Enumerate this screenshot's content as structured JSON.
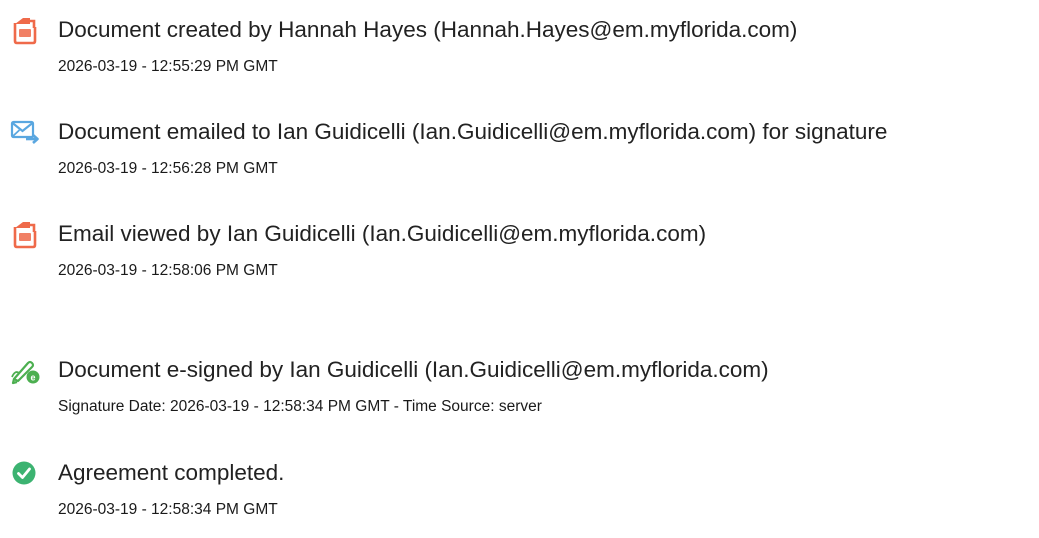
{
  "colors": {
    "doc_icon": "#ef6a4a",
    "email_icon": "#5aa7e0",
    "sign_icon": "#4caf50",
    "check_icon": "#3cb371"
  },
  "events": [
    {
      "icon": "document-icon",
      "title": "Document created by Hannah Hayes (Hannah.Hayes@em.myflorida.com)",
      "timestamp": "2026-03-19 - 12:55:29 PM GMT"
    },
    {
      "icon": "email-sent-icon",
      "title": "Document emailed to Ian Guidicelli (Ian.Guidicelli@em.myflorida.com) for signature",
      "timestamp": "2026-03-19 - 12:56:28 PM GMT"
    },
    {
      "icon": "document-icon",
      "title": "Email viewed by Ian Guidicelli (Ian.Guidicelli@em.myflorida.com)",
      "timestamp": "2026-03-19 - 12:58:06 PM GMT"
    },
    {
      "icon": "esign-pen-icon",
      "title": "Document e-signed by Ian Guidicelli (Ian.Guidicelli@em.myflorida.com)",
      "timestamp": "Signature Date: 2026-03-19 - 12:58:34 PM GMT - Time Source: server"
    },
    {
      "icon": "check-circle-icon",
      "title": "Agreement completed.",
      "timestamp": "2026-03-19 - 12:58:34 PM GMT"
    }
  ]
}
